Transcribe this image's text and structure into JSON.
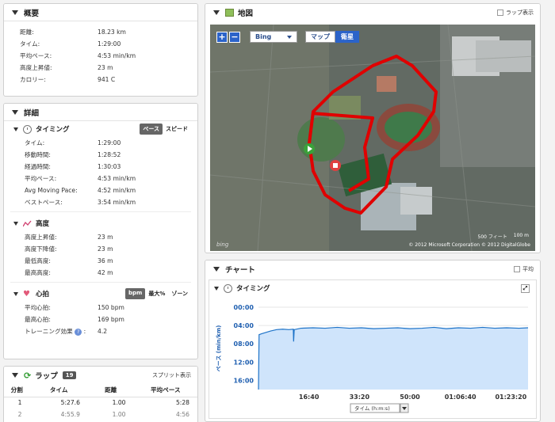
{
  "summary": {
    "title": "概要",
    "rows": [
      {
        "label": "距離:",
        "value": "18.23 km"
      },
      {
        "label": "タイム:",
        "value": "1:29:00"
      },
      {
        "label": "平均ペース:",
        "value": "4:53 min/km"
      },
      {
        "label": "高度上昇値:",
        "value": "23 m"
      },
      {
        "label": "カロリー:",
        "value": "941 C"
      }
    ]
  },
  "details": {
    "title": "詳細",
    "timing": {
      "title": "タイミング",
      "toggle_pace": "ペース",
      "toggle_speed": "スピード",
      "rows": [
        {
          "label": "タイム:",
          "value": "1:29:00"
        },
        {
          "label": "移動時間:",
          "value": "1:28:52"
        },
        {
          "label": "経過時間:",
          "value": "1:30:03"
        },
        {
          "label": "平均ペース:",
          "value": "4:53 min/km"
        },
        {
          "label": "Avg Moving Pace:",
          "value": "4:52 min/km"
        },
        {
          "label": "ベストペース:",
          "value": "3:54 min/km"
        }
      ]
    },
    "elevation": {
      "title": "高度",
      "rows": [
        {
          "label": "高度上昇値:",
          "value": "23 m"
        },
        {
          "label": "高度下降値:",
          "value": "23 m"
        },
        {
          "label": "最低高度:",
          "value": "36 m"
        },
        {
          "label": "最高高度:",
          "value": "42 m"
        }
      ]
    },
    "heart": {
      "title": "心拍",
      "toggle_bpm": "bpm",
      "toggle_max": "最大%",
      "toggle_zone": "ゾーン",
      "rows": [
        {
          "label": "平均心拍:",
          "value": "150 bpm"
        },
        {
          "label": "最高心拍:",
          "value": "169 bpm"
        },
        {
          "label": "トレーニング効果",
          "value": "4.2"
        }
      ]
    }
  },
  "laps": {
    "title": "ラップ",
    "count": "19",
    "split_label": "スプリット表示",
    "headers": [
      "分割",
      "タイム",
      "距離",
      "平均ペース"
    ],
    "rows": [
      [
        "1",
        "5:27.6",
        "1.00",
        "5:28"
      ],
      [
        "2",
        "4:55.9",
        "1.00",
        "4:56"
      ]
    ]
  },
  "map": {
    "title": "地図",
    "lap_label": "ラップ表示",
    "provider": "Bing",
    "btn_map": "マップ",
    "btn_sat": "衛星",
    "zoom_in": "+",
    "zoom_out": "−",
    "scale_ft": "500 フィート",
    "scale_m": "100 m",
    "copyright": "© 2012 Microsoft Corporation   © 2012 DigitalGlobe",
    "brand": "bing"
  },
  "chart": {
    "title": "チャート",
    "avg_label": "平均",
    "sub_title": "タイミング",
    "axis_select": "タイム (h:m:s)",
    "ylabel": "ペース (min/km)"
  },
  "chart_data": {
    "type": "area",
    "ylabel": "ペース (min/km)",
    "xlabel": "タイム (h:m:s)",
    "y_ticks": [
      "00:00",
      "04:00",
      "08:00",
      "12:00",
      "16:00"
    ],
    "x_ticks": [
      "16:40",
      "33:20",
      "50:00",
      "01:06:40",
      "01:23:20"
    ],
    "ylim": [
      0,
      18
    ],
    "y_inverted": true,
    "series": [
      {
        "values": [
          [
            0,
            18
          ],
          [
            0.2,
            6
          ],
          [
            1,
            5.8
          ],
          [
            4,
            5.2
          ],
          [
            6,
            4.9
          ],
          [
            8,
            4.8
          ],
          [
            10,
            4.9
          ],
          [
            11.5,
            4.8
          ],
          [
            11.6,
            7.5
          ],
          [
            11.8,
            4.9
          ],
          [
            14,
            4.6
          ],
          [
            18,
            4.5
          ],
          [
            22,
            4.6
          ],
          [
            26,
            4.4
          ],
          [
            30,
            4.6
          ],
          [
            34,
            4.5
          ],
          [
            38,
            4.7
          ],
          [
            42,
            4.6
          ],
          [
            46,
            4.5
          ],
          [
            50,
            4.7
          ],
          [
            54,
            4.6
          ],
          [
            58,
            4.4
          ],
          [
            62,
            4.7
          ],
          [
            66,
            4.5
          ],
          [
            70,
            4.6
          ],
          [
            74,
            4.4
          ],
          [
            78,
            4.6
          ],
          [
            82,
            4.5
          ],
          [
            86,
            4.6
          ],
          [
            89,
            4.5
          ]
        ]
      }
    ],
    "xlim_minutes": [
      0,
      89
    ],
    "fill_color": "#cfe4fb",
    "line_color": "#1e73c8"
  },
  "colors": {
    "route": "#e00000",
    "accent": "#2b63c9"
  }
}
